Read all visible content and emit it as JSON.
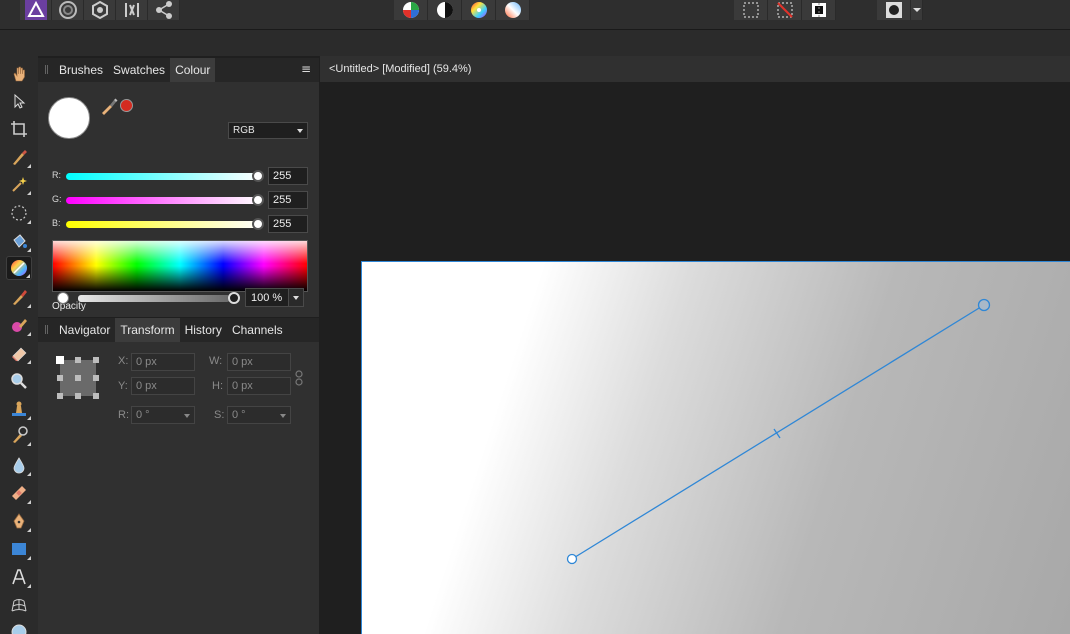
{
  "panels": {
    "colour": {
      "tabs": [
        "Brushes",
        "Swatches",
        "Colour"
      ],
      "active_tab": "Colour",
      "model": "RGB",
      "channels": [
        {
          "label": "R:",
          "value": "255"
        },
        {
          "label": "G:",
          "value": "255"
        },
        {
          "label": "B:",
          "value": "255"
        }
      ],
      "opacity_label": "Opacity",
      "opacity_value": "100 %",
      "opacity_level": 1.0,
      "primary_color": "#ffffff",
      "secondary_color": "#d42b20"
    },
    "transform": {
      "tabs": [
        "Navigator",
        "Transform",
        "History",
        "Channels"
      ],
      "active_tab": "Transform",
      "fields": {
        "x": {
          "label": "X:",
          "value": "0 px"
        },
        "y": {
          "label": "Y:",
          "value": "0 px"
        },
        "w": {
          "label": "W:",
          "value": "0 px"
        },
        "h": {
          "label": "H:",
          "value": "0 px"
        },
        "r": {
          "label": "R:",
          "value": "0 °"
        },
        "s": {
          "label": "S:",
          "value": "0 °"
        }
      }
    }
  },
  "document": {
    "title": "<Untitled> [Modified] (59.4%)"
  },
  "colors": {
    "accent": "#2f87d6",
    "panel": "#303030",
    "background": "#1f1f1f"
  },
  "icons": {
    "personas": [
      "photo-persona-icon",
      "liquify-persona-icon",
      "develop-persona-icon",
      "tone-mapping-persona-icon",
      "export-persona-icon"
    ],
    "adjust": [
      "auto-levels-icon",
      "auto-contrast-icon",
      "auto-colour-icon",
      "auto-white-balance-icon"
    ],
    "selection": [
      "marquee-selection-icon",
      "no-selection-icon",
      "invert-selection-icon"
    ],
    "tools": [
      "view-tool-icon",
      "move-tool-icon",
      "crop-tool-icon",
      "selection-brush-icon",
      "flood-select-icon",
      "marquee-tool-icon",
      "flood-fill-icon",
      "gradient-tool-icon",
      "paint-brush-icon",
      "colour-replacement-icon",
      "erase-brush-icon",
      "zoom-tool-icon",
      "clone-tool-icon",
      "dodge-brush-icon",
      "blur-brush-icon",
      "healing-brush-icon",
      "pen-tool-icon",
      "rectangle-tool-icon",
      "text-tool-icon",
      "mesh-warp-icon",
      "red-eye-icon"
    ]
  }
}
